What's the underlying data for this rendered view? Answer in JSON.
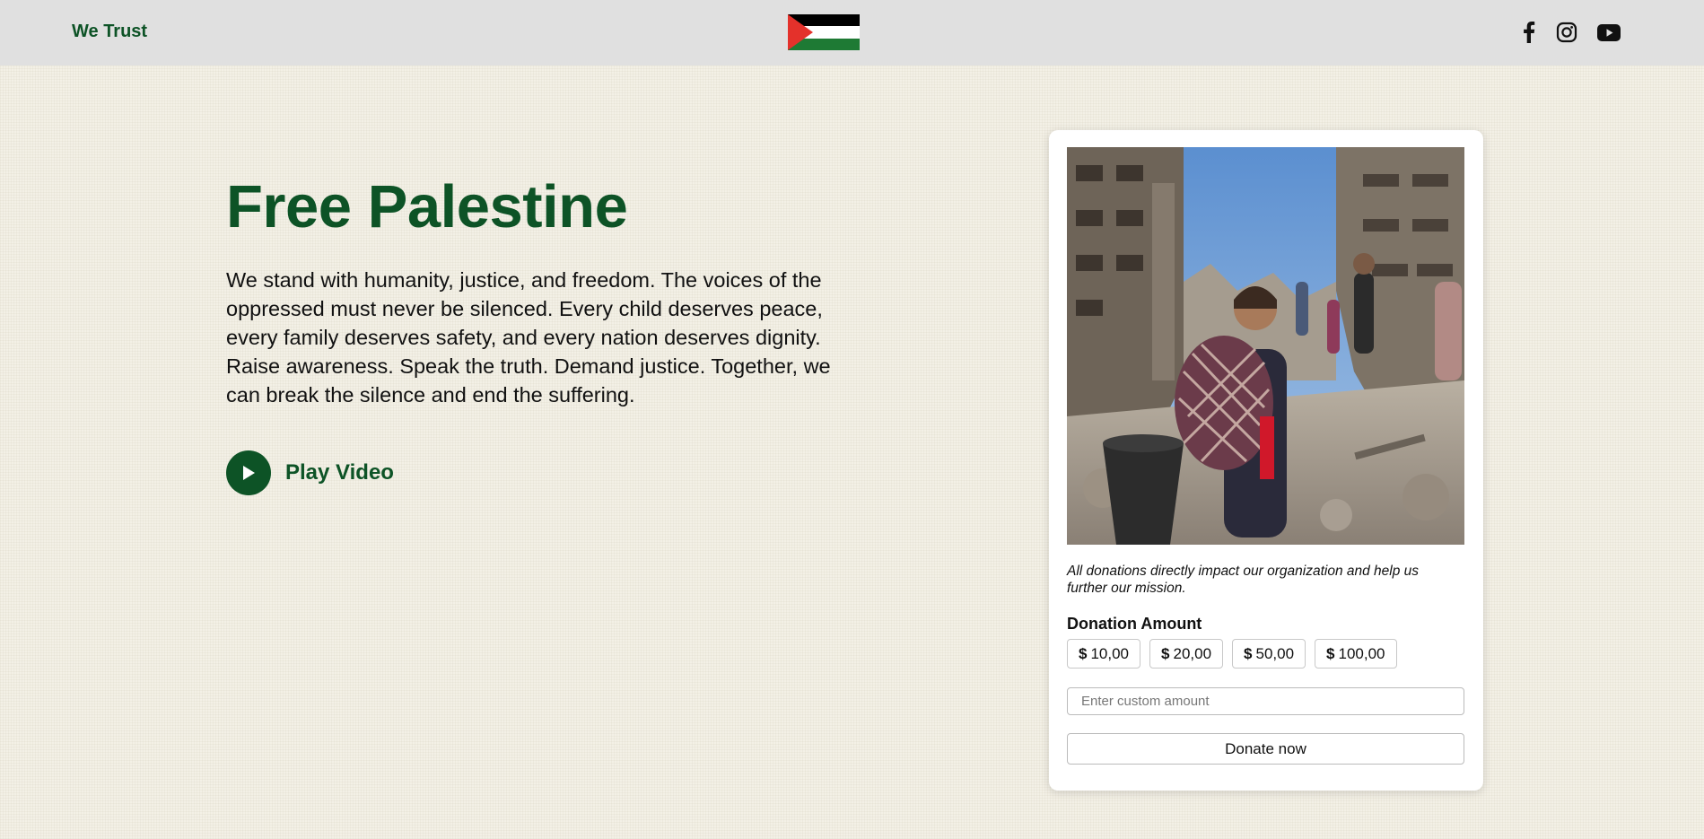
{
  "header": {
    "brand": "We Trust",
    "flag_colors": [
      "#000000",
      "#ffffff",
      "#1e7a34",
      "#e4312b"
    ],
    "social_icons": [
      "facebook-icon",
      "instagram-icon",
      "youtube-icon"
    ]
  },
  "hero": {
    "title": "Free Palestine",
    "text": "We stand with humanity, justice, and freedom. The voices of the oppressed must never be silenced. Every child deserves peace, every family deserves safety, and every nation deserves dignity. Raise awareness. Speak the truth. Demand justice. Together, we can break the silence and end the suffering.",
    "play_label": "Play Video"
  },
  "donation": {
    "image_alt": "Child holding a bag among ruins",
    "note": "All donations directly impact our organization and help us further our mission.",
    "amount_label": "Donation Amount",
    "currency": "$",
    "amounts": [
      "10,00",
      "20,00",
      "50,00",
      "100,00"
    ],
    "custom_placeholder": "Enter custom amount",
    "donate_label": "Donate now"
  },
  "colors": {
    "brand_green": "#0d5326",
    "header_bg": "#e0e0e0",
    "page_bg": "#f3f0e6"
  }
}
